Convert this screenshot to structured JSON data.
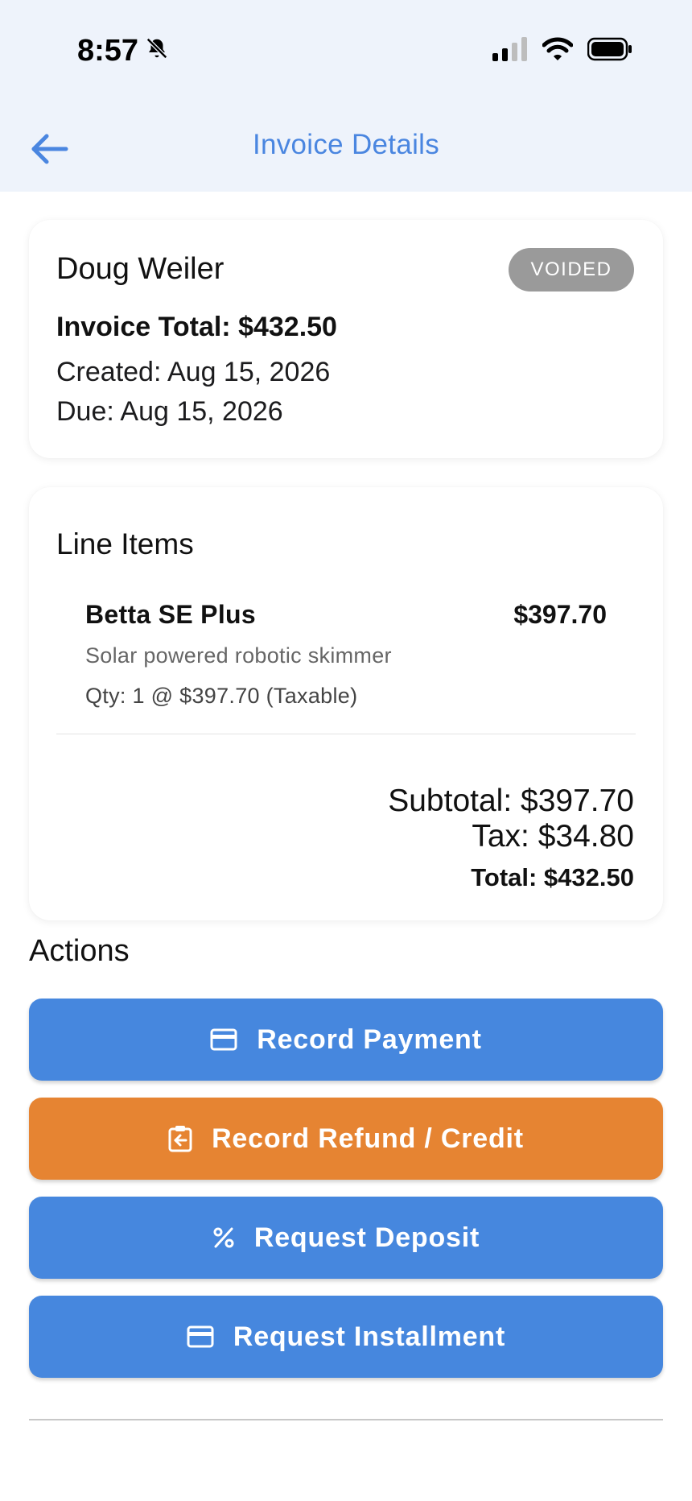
{
  "status_bar": {
    "time": "8:57"
  },
  "nav": {
    "title": "Invoice Details"
  },
  "invoice": {
    "customer": "Doug Weiler",
    "status": "VOIDED",
    "total_label": "Invoice Total: $432.50",
    "created": "Created: Aug 15, 2026",
    "due": "Due: Aug 15, 2026"
  },
  "line_items": {
    "heading": "Line Items",
    "items": [
      {
        "name": "Betta SE Plus",
        "price": "$397.70",
        "description": "Solar powered robotic skimmer",
        "qty": "Qty: 1 @ $397.70 (Taxable)"
      }
    ],
    "subtotal": "Subtotal: $397.70",
    "tax": "Tax: $34.80",
    "total": "Total: $432.50"
  },
  "actions": {
    "heading": "Actions",
    "buttons": [
      {
        "label": "Record Payment",
        "icon": "credit-card-icon",
        "color": "#4687de"
      },
      {
        "label": "Record Refund / Credit",
        "icon": "refund-clipboard-icon",
        "color": "#e68432"
      },
      {
        "label": "Request Deposit",
        "icon": "percent-icon",
        "color": "#4687de"
      },
      {
        "label": "Request Installment",
        "icon": "credit-card-icon",
        "color": "#4687de"
      }
    ]
  },
  "colors": {
    "accent": "#4a86e0",
    "header_bg": "#eef3fb",
    "badge_voided": "#9a9a9a"
  }
}
